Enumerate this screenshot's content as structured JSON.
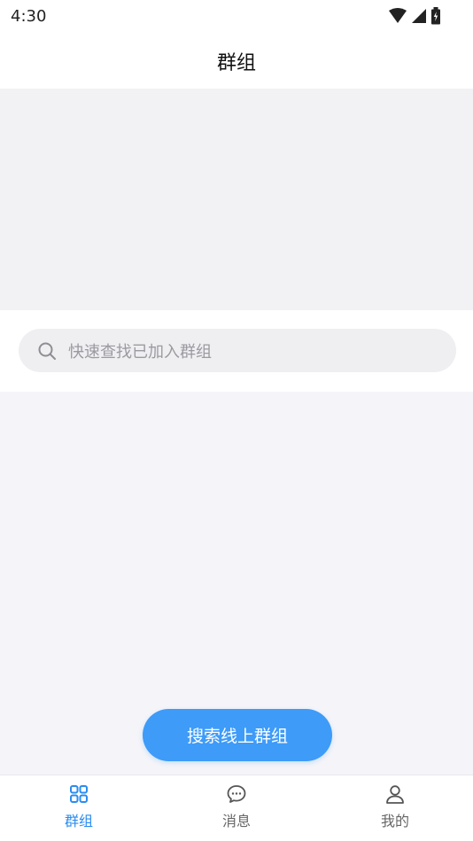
{
  "status_bar": {
    "time": "4:30",
    "icons": [
      "wifi-icon",
      "signal-icon",
      "battery-icon"
    ]
  },
  "nav": {
    "title": "群组"
  },
  "search": {
    "placeholder": "快速查找已加入群组",
    "icon": "search-icon"
  },
  "actions": {
    "search_online_label": "搜索线上群组"
  },
  "tabs": [
    {
      "label": "群组",
      "icon": "grid-icon",
      "active": true
    },
    {
      "label": "消息",
      "icon": "chat-icon",
      "active": false
    },
    {
      "label": "我的",
      "icon": "user-icon",
      "active": false
    }
  ],
  "colors": {
    "accent": "#3e9bf8",
    "tab_active": "#2a8cf0",
    "tab_inactive": "#666666",
    "banner_bg": "#f2f2f5",
    "list_bg": "#f5f5f9",
    "search_bg": "#efeff2"
  }
}
